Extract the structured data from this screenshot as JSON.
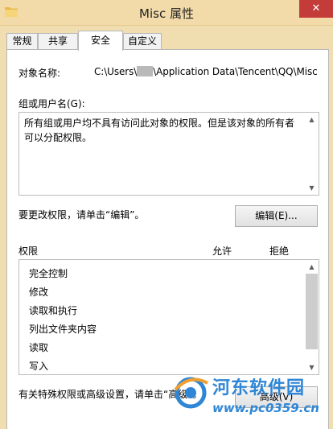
{
  "window": {
    "title": "Misc 属性",
    "close_label": "✕"
  },
  "tabs": [
    {
      "label": "常规",
      "active": false
    },
    {
      "label": "共享",
      "active": false
    },
    {
      "label": "安全",
      "active": true
    },
    {
      "label": "自定义",
      "active": false
    }
  ],
  "security": {
    "object_name_label": "对象名称:",
    "object_name_prefix": "C:\\Users\\",
    "object_name_suffix": "\\Application Data\\Tencent\\QQ\\Misc",
    "group_label": "组或用户名(G):",
    "group_message": "所有组或用户均不具有访问此对象的权限。但是该对象的所有者可以分配权限。",
    "change_note": "要更改权限，请单击“编辑”。",
    "edit_button": "编辑(E)...",
    "permissions_header": "权限",
    "allow_header": "允许",
    "deny_header": "拒绝",
    "permissions": [
      "完全控制",
      "修改",
      "读取和执行",
      "列出文件夹内容",
      "读取",
      "写入"
    ],
    "advanced_note": "有关特殊权限或高级设置，请单击“高级”。",
    "advanced_button": "高级(V)"
  },
  "watermark": {
    "name": "河东软件园",
    "url": "www.pc0359.cn"
  },
  "colors": {
    "titlebar": "#f3dba9",
    "close": "#c43c3a",
    "watermark": "#2f86d6"
  }
}
